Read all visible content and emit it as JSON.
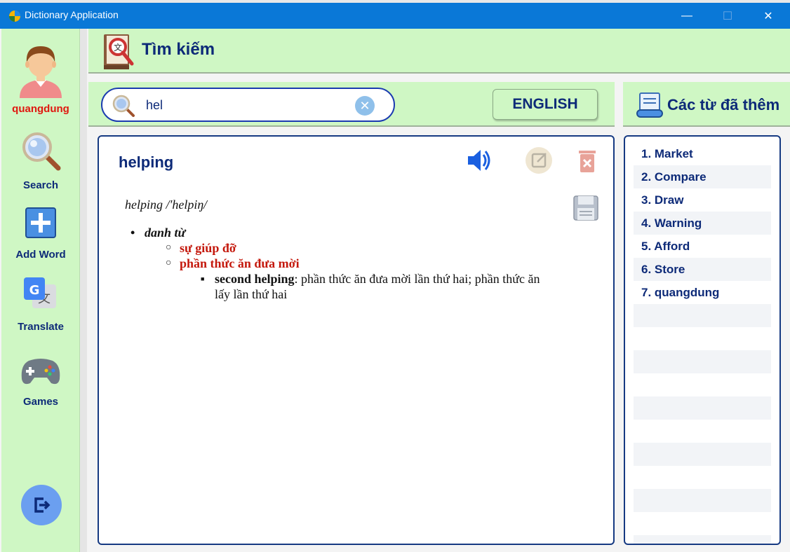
{
  "window": {
    "title": "Dictionary Application",
    "min": "—",
    "max": "☐",
    "close": "✕"
  },
  "sidebar": {
    "username": "quangdung",
    "items": [
      {
        "label": "Search",
        "icon": "magnifier-icon"
      },
      {
        "label": "Add Word",
        "icon": "plus-icon"
      },
      {
        "label": "Translate",
        "icon": "translate-icon"
      },
      {
        "label": "Games",
        "icon": "gamepad-icon"
      }
    ],
    "logout_icon": "logout-icon"
  },
  "header": {
    "title": "Tìm kiếm",
    "icon": "dictionary-book-icon"
  },
  "search": {
    "value": "hel",
    "clear": "✕",
    "language_button": "ENGLISH"
  },
  "definition": {
    "word": "helping",
    "pronunciation": "helping /'helpiŋ/",
    "part_of_speech": "danh từ",
    "meanings": [
      "sự giúp đỡ",
      "phần thức ăn đưa mời"
    ],
    "example_term": "second helping",
    "example_text": ": phần thức ăn đưa mời lần thứ hai; phần thức ăn lấy lần thứ hai"
  },
  "added_words": {
    "title": "Các từ đã thêm",
    "items": [
      "1. Market",
      "2. Compare",
      "3. Draw",
      "4. Warning",
      "5. Afford",
      "6. Store",
      "7. quangdung"
    ]
  },
  "colors": {
    "accent_green": "#cff7c4",
    "titlebar_blue": "#0a78d7",
    "navy": "#0d2a78",
    "red": "#e0170f"
  }
}
